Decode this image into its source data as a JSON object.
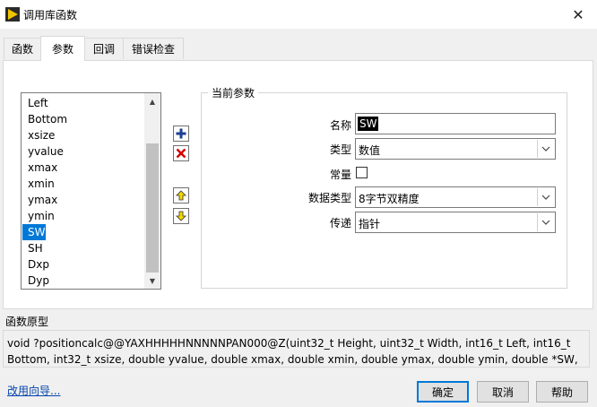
{
  "window": {
    "title": "调用库函数",
    "close_glyph": "✕"
  },
  "tabs": [
    {
      "label": "函数",
      "active": false
    },
    {
      "label": "参数",
      "active": true
    },
    {
      "label": "回调",
      "active": false
    },
    {
      "label": "错误检查",
      "active": false
    }
  ],
  "param_list": {
    "items": [
      "Left",
      "Bottom",
      "xsize",
      "yvalue",
      "xmax",
      "xmin",
      "ymax",
      "ymin",
      "SW",
      "SH",
      "Dxp",
      "Dyp"
    ],
    "selected": "SW"
  },
  "current_param": {
    "group_label": "当前参数",
    "name_label": "名称",
    "name_value": "SW",
    "type_label": "类型",
    "type_value": "数值",
    "const_label": "常量",
    "const_checked": false,
    "datatype_label": "数据类型",
    "datatype_value": "8字节双精度",
    "pass_label": "传递",
    "pass_value": "指针"
  },
  "prototype": {
    "label": "函数原型",
    "text": "void  ?positioncalc@@YAXHHHHHNNNNNPAN000@Z(uint32_t Height, uint32_t Width, int16_t Left, int16_t Bottom, int32_t xsize, double yvalue, double xmax, double xmin, double ymax, double ymin, double *SW, double *SH, double *Dxp, double *Dyp);"
  },
  "footer": {
    "help_link": "改用向导...",
    "ok": "确定",
    "cancel": "取消",
    "help": "帮助"
  },
  "colors": {
    "selection": "#0078d7",
    "add_icon": "#1c3f94",
    "delete_icon": "#d40000",
    "arrow_icon": "#f5d800"
  }
}
